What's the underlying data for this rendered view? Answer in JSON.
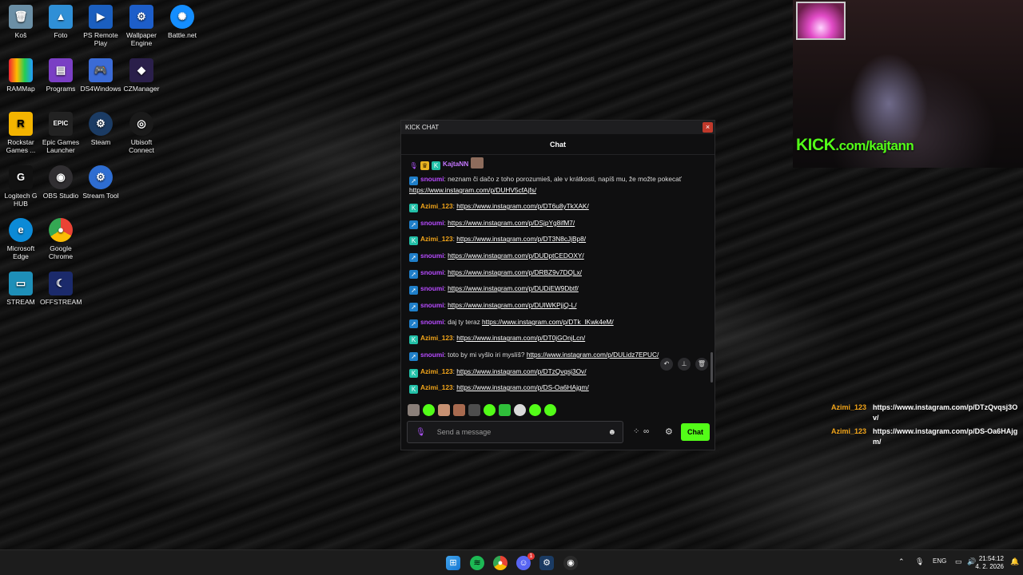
{
  "desktop": {
    "icons": [
      {
        "label": "Koš"
      },
      {
        "label": "Foto"
      },
      {
        "label": "PS Remote Play"
      },
      {
        "label": "Wallpaper Engine"
      },
      {
        "label": "Battle.net"
      },
      {
        "label": "RAMMap"
      },
      {
        "label": "Programs"
      },
      {
        "label": "DS4Windows"
      },
      {
        "label": "CZManager"
      },
      {
        "label": "Rockstar Games ..."
      },
      {
        "label": "Epic Games Launcher"
      },
      {
        "label": "Steam"
      },
      {
        "label": "Ubisoft Connect"
      },
      {
        "label": "Logitech G HUB"
      },
      {
        "label": "OBS Studio"
      },
      {
        "label": "Stream Tool"
      },
      {
        "label": "Microsoft Edge"
      },
      {
        "label": "Google Chrome"
      },
      {
        "label": "STREAM"
      },
      {
        "label": "OFFSTREAM"
      }
    ]
  },
  "chat_window": {
    "title": "KICK CHAT",
    "close": "×",
    "header": "Chat",
    "messages": [
      {
        "user": "KajtaNN",
        "sep": "",
        "text": "",
        "link": ""
      },
      {
        "user": "snoumi",
        "sep": ":",
        "text": "neznam či dačo z toho porozumieš, ale v krátkosti, napíš mu, že možte pokecať",
        "link": "https://www.instagram.com/p/DUHV5cfAjfs/"
      },
      {
        "user": "Azimi_123",
        "sep": ":",
        "text": "",
        "link": "https://www.instagram.com/p/DT6u8yTkXAK/"
      },
      {
        "user": "snoumi",
        "sep": ":",
        "text": "",
        "link": "https://www.instagram.com/p/DSjpYg8ifM7/"
      },
      {
        "user": "Azimi_123",
        "sep": ":",
        "text": "",
        "link": "https://www.instagram.com/p/DT3N8cJjBp8/"
      },
      {
        "user": "snoumi",
        "sep": ":",
        "text": "",
        "link": "https://www.instagram.com/p/DUDptCEDOXY/"
      },
      {
        "user": "snoumi",
        "sep": ":",
        "text": "",
        "link": "https://www.instagram.com/p/DRBZ9v7DQLx/"
      },
      {
        "user": "snoumi",
        "sep": ":",
        "text": "",
        "link": "https://www.instagram.com/p/DUDiEW9Dbtf/"
      },
      {
        "user": "snoumi",
        "sep": ":",
        "text": "",
        "link": "https://www.instagram.com/p/DUIWKPjjQ-L/"
      },
      {
        "user": "snoumi",
        "sep": ":",
        "text": "daj ty teraz",
        "link": "https://www.instagram.com/p/DTk_IKwk4eM/"
      },
      {
        "user": "Azimi_123",
        "sep": ":",
        "text": "",
        "link": "https://www.instagram.com/p/DT0jGOnjLcn/"
      },
      {
        "user": "snoumi",
        "sep": ":",
        "text": "toto by mi vyšlo iri myslíš?",
        "link": "https://www.instagram.com/p/DULidz7EPUC/"
      },
      {
        "user": "Azimi_123",
        "sep": ":",
        "text": "",
        "link": "https://www.instagram.com/p/DTzQvqsj3Ov/"
      },
      {
        "user": "Azimi_123",
        "sep": ":",
        "text": "",
        "link": "https://www.instagram.com/p/DS-Oa6HAjgm/"
      }
    ],
    "input_placeholder": "Send a message",
    "send_label": "Chat"
  },
  "webcam": {
    "kick_brand": "KICK",
    "kick_url": ".com/kajtann"
  },
  "overlay_chat": [
    {
      "user": "Azimi_123",
      "text": "https://www.instagram.com/p/DTzQvqsj3Ov/"
    },
    {
      "user": "Azimi_123",
      "text": "https://www.instagram.com/p/DS-Oa6HAjgm/"
    }
  ],
  "taskbar": {
    "lang": "ENG",
    "time": "21:54:12",
    "date": "4. 2. 2026",
    "discord_badge": "1"
  }
}
